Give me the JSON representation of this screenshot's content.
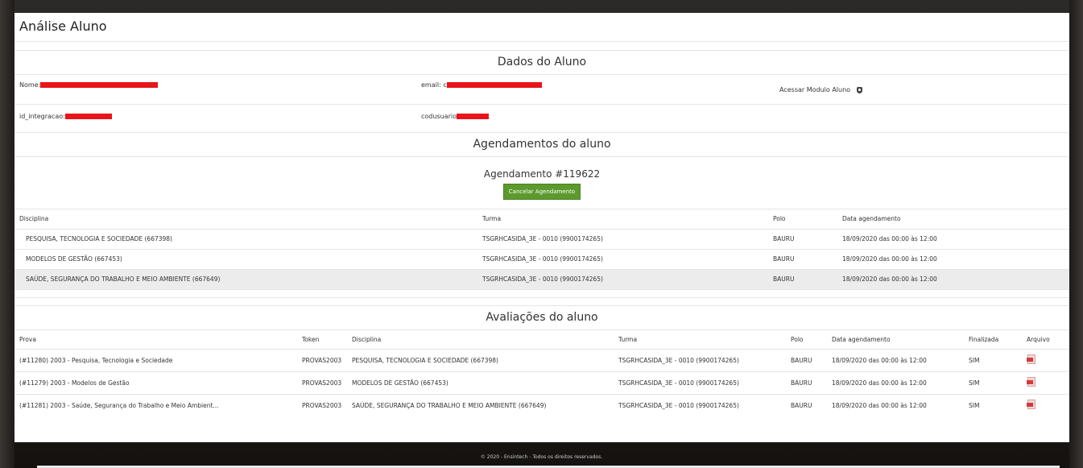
{
  "page_title": "Análise Aluno",
  "student_section": {
    "title": "Dados do Aluno",
    "nome_label": "Nome:",
    "email_label": "email:",
    "email_visible": "c",
    "access_label": "Acessar Modulo Aluno",
    "id_label": "id_integracao:",
    "cod_label": "codusuario"
  },
  "scheduling": {
    "title": "Agendamentos do aluno",
    "heading": "Agendamento #119622",
    "cancel_label": "Cancelar Agendamento",
    "columns": [
      "Disciplina",
      "Turma",
      "Polo",
      "Data agendamento"
    ],
    "rows": [
      {
        "disciplina": "PESQUISA, TECNOLOGIA E SOCIEDADE (667398)",
        "turma": "TSGRHCASIDA_3E - 0010 (9900174265)",
        "polo": "BAURU",
        "data": "18/09/2020 das 00:00 às 12:00"
      },
      {
        "disciplina": "MODELOS DE GESTÃO (667453)",
        "turma": "TSGRHCASIDA_3E - 0010 (9900174265)",
        "polo": "BAURU",
        "data": "18/09/2020 das 00:00 às 12:00"
      },
      {
        "disciplina": "SAÚDE, SEGURANÇA DO TRABALHO E MEIO AMBIENTE (667649)",
        "turma": "TSGRHCASIDA_3E - 0010 (9900174265)",
        "polo": "BAURU",
        "data": "18/09/2020 das 00:00 às 12:00"
      }
    ]
  },
  "evaluations": {
    "title": "Avaliações do aluno",
    "columns": [
      "Prova",
      "Token",
      "Disciplina",
      "Turma",
      "Polo",
      "Data agendamento",
      "Finalizada",
      "Arquivo"
    ],
    "rows": [
      {
        "prova": "(#11280) 2003 - Pesquisa, Tecnologia e Sociedade",
        "token": "PROVAS2003",
        "disciplina": "PESQUISA, TECNOLOGIA E SOCIEDADE (667398)",
        "turma": "TSGRHCASIDA_3E - 0010 (9900174265)",
        "polo": "BAURU",
        "data": "18/09/2020 das 00:00 às 12:00",
        "finalizada": "SIM",
        "arquivo_icon": "pdf-icon"
      },
      {
        "prova": "(#11279) 2003 - Modelos de Gestão",
        "token": "PROVAS2003",
        "disciplina": "MODELOS DE GESTÃO (667453)",
        "turma": "TSGRHCASIDA_3E - 0010 (9900174265)",
        "polo": "BAURU",
        "data": "18/09/2020 das 00:00 às 12:00",
        "finalizada": "SIM",
        "arquivo_icon": "pdf-icon"
      },
      {
        "prova": "(#11281) 2003 - Saúde, Segurança do Trabalho e Meio Ambient...",
        "token": "PROVAS2003",
        "disciplina": "SAÚDE, SEGURANÇA DO TRABALHO E MEIO AMBIENTE (667649)",
        "turma": "TSGRHCASIDA_3E - 0010 (9900174265)",
        "polo": "BAURU",
        "data": "18/09/2020 das 00:00 às 12:00",
        "finalizada": "SIM",
        "arquivo_icon": "pdf-icon"
      }
    ]
  },
  "footer": "© 2020 - Ensintech - Todos os direitos reservados.",
  "colors": {
    "button": "#5c9a2e",
    "redaction": "#e8141a",
    "highlight_row": "#ececec"
  }
}
